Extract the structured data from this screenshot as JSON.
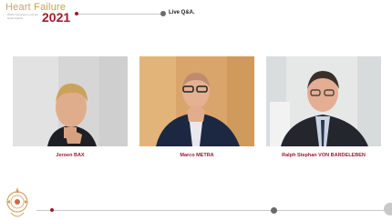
{
  "header": {
    "logo_heart": "Heart",
    "logo_failure": "Failure",
    "logo_subtitle": "World Congress on Acute Heart Failure",
    "logo_year": "2021",
    "session_title": "Live Q&A."
  },
  "speakers": [
    {
      "name": "Jeroen BAX"
    },
    {
      "name": "Marco METRA"
    },
    {
      "name": "Ralph Stephan VON BARDELEBEN"
    }
  ],
  "colors": {
    "accent": "#9b1b30",
    "brand_gold": "#c8a24a"
  }
}
